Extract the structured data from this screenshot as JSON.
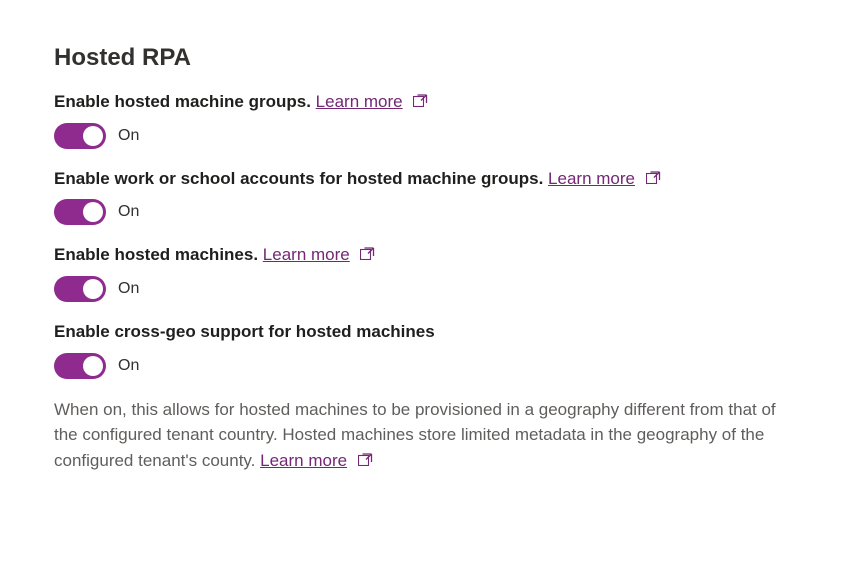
{
  "section": {
    "title": "Hosted RPA"
  },
  "link_text": "Learn more",
  "toggle_on_label": "On",
  "settings": {
    "hosted_machine_groups": {
      "label": "Enable hosted machine groups.",
      "state": "On"
    },
    "work_school_accounts": {
      "label": "Enable work or school accounts for hosted machine groups.",
      "state": "On"
    },
    "hosted_machines": {
      "label": "Enable hosted machines.",
      "state": "On"
    },
    "cross_geo": {
      "label": "Enable cross-geo support for hosted machines",
      "state": "On",
      "description": "When on, this allows for hosted machines to be provisioned in a geography different from that of the configured tenant country. Hosted machines store limited metadata in the geography of the configured tenant's county."
    }
  }
}
